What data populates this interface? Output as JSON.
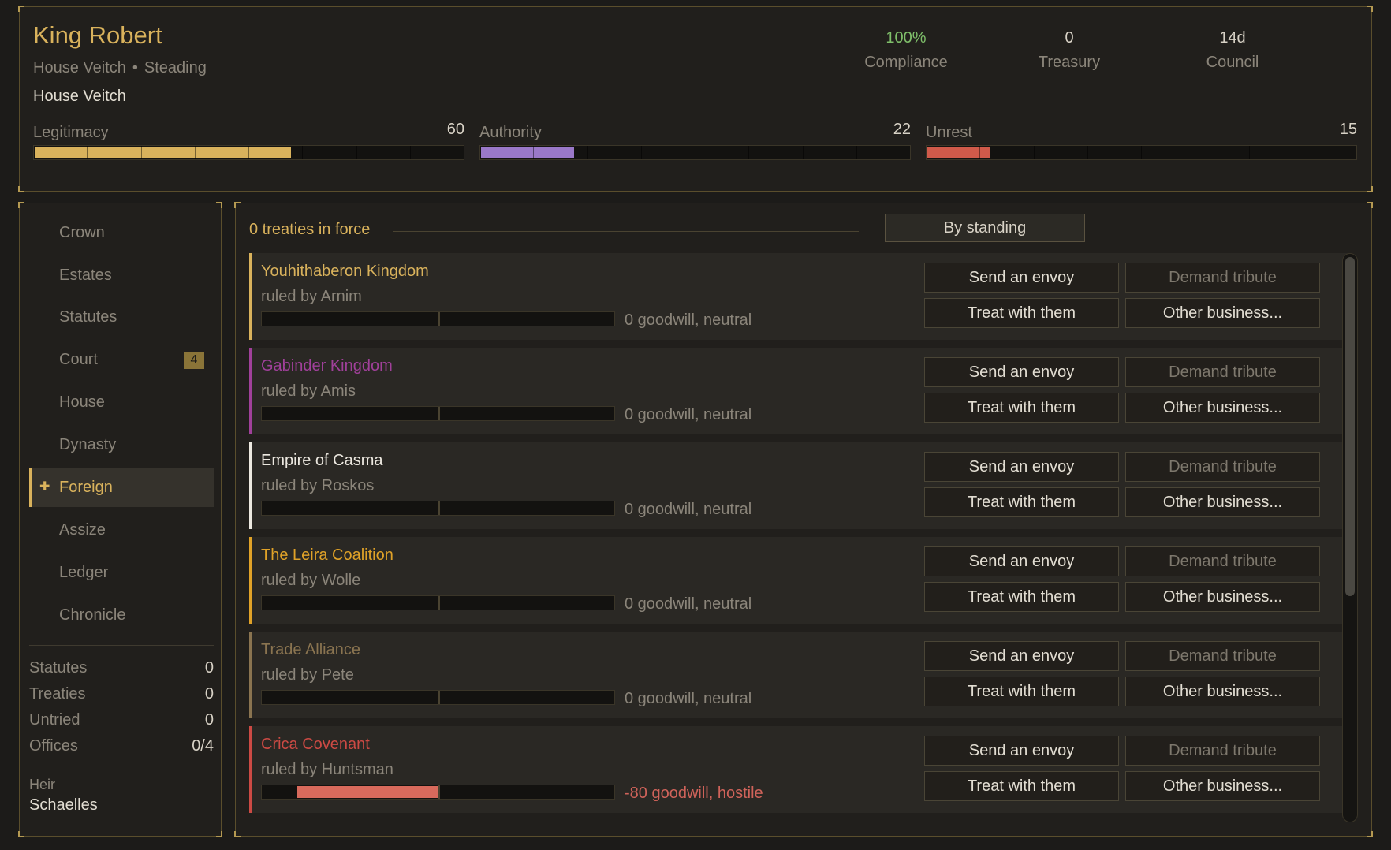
{
  "ruler": {
    "name": "King Robert",
    "house": "House Veitch",
    "sep": "•",
    "seat": "Steading",
    "house_line": "House Veitch"
  },
  "stats": [
    {
      "value": "100%",
      "label": "Compliance"
    },
    {
      "value": "0",
      "label": "Treasury"
    },
    {
      "value": "14d",
      "label": "Council"
    }
  ],
  "meters": [
    {
      "label": "Legitimacy",
      "value": "60",
      "fraction": 0.6,
      "color": "#d9b25c"
    },
    {
      "label": "Authority",
      "value": "22",
      "fraction": 0.22,
      "color": "#9a78c8"
    },
    {
      "label": "Unrest",
      "value": "15",
      "fraction": 0.15,
      "color": "#d05a4a"
    }
  ],
  "nav": {
    "items": [
      {
        "label": "Crown"
      },
      {
        "label": "Estates"
      },
      {
        "label": "Statutes"
      },
      {
        "label": "Court",
        "badge": "4"
      },
      {
        "label": "House"
      },
      {
        "label": "Dynasty"
      },
      {
        "label": "Foreign",
        "active": true,
        "mark": "✚"
      },
      {
        "label": "Assize"
      },
      {
        "label": "Ledger"
      },
      {
        "label": "Chronicle"
      }
    ]
  },
  "summary": [
    {
      "label": "Statutes",
      "value": "0"
    },
    {
      "label": "Treaties",
      "value": "0"
    },
    {
      "label": "Untried",
      "value": "0"
    },
    {
      "label": "Offices",
      "value": "0/4"
    }
  ],
  "heir": {
    "label": "Heir",
    "name": "Schaelles"
  },
  "foreign": {
    "treaty_count": "0 treaties in force",
    "sort_label": "By standing",
    "buttons": {
      "envoy": "Send an envoy",
      "tribute": "Demand tribute",
      "treat": "Treat with them",
      "other": "Other business..."
    },
    "realms": [
      {
        "name": "Youhithaberon Kingdom",
        "ruler": "ruled by Arnim",
        "goodwill": "0 goodwill, neutral",
        "goodwill_value": 0,
        "color": "#d9b25c",
        "text_color": "#8b857a"
      },
      {
        "name": "Gabinder Kingdom",
        "ruler": "ruled by Amis",
        "goodwill": "0 goodwill, neutral",
        "goodwill_value": 0,
        "color": "#a0409a",
        "text_color": "#8b857a"
      },
      {
        "name": "Empire of Casma",
        "ruler": "ruled by Roskos",
        "goodwill": "0 goodwill, neutral",
        "goodwill_value": 0,
        "color": "#ece8e0",
        "text_color": "#8b857a"
      },
      {
        "name": "The Leira Coalition",
        "ruler": "ruled by Wolle",
        "goodwill": "0 goodwill, neutral",
        "goodwill_value": 0,
        "color": "#e0a228",
        "text_color": "#8b857a"
      },
      {
        "name": "Trade Alliance",
        "ruler": "ruled by Pete",
        "goodwill": "0 goodwill, neutral",
        "goodwill_value": 0,
        "color": "#8a7450",
        "text_color": "#8b857a"
      },
      {
        "name": "Crica Covenant",
        "ruler": "ruled by Huntsman",
        "goodwill": "-80 goodwill, hostile",
        "goodwill_value": -80,
        "color": "#cc4a44",
        "text_color": "#d0635a"
      }
    ]
  }
}
